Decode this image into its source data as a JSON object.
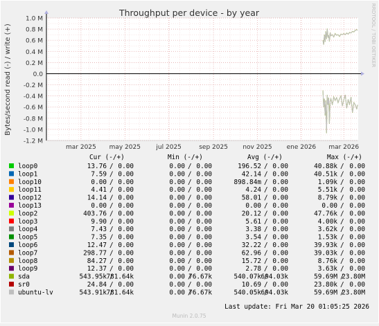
{
  "page": {
    "title": "Throughput per device - by year",
    "watermark": "RRDTOOL / TOBI OETIKER",
    "footer": "Munin 2.0.75",
    "last_update": "Last update: Fri Mar 20 01:05:25 2026"
  },
  "legend": {
    "headers": {
      "cur": "Cur (-/+)",
      "min": "Min (-/+)",
      "avg": "Avg (-/+)",
      "max": "Max (-/+)"
    },
    "rows": [
      {
        "name": "loop0",
        "color": "#00cc00",
        "cur_r": "13.76",
        "cur_w": "0.00",
        "min_r": "0.00",
        "min_w": "0.00",
        "avg_r": "196.52",
        "avg_w": "0.00",
        "max_r": "40.88k",
        "max_w": "0.00"
      },
      {
        "name": "loop1",
        "color": "#0066b3",
        "cur_r": "7.59",
        "cur_w": "0.00",
        "min_r": "0.00",
        "min_w": "0.00",
        "avg_r": "42.14",
        "avg_w": "0.00",
        "max_r": "40.51k",
        "max_w": "0.00"
      },
      {
        "name": "loop10",
        "color": "#ff8000",
        "cur_r": "0.00",
        "cur_w": "0.00",
        "min_r": "0.00",
        "min_w": "0.00",
        "avg_r": "898.84m",
        "avg_w": "0.00",
        "max_r": "1.09k",
        "max_w": "0.00"
      },
      {
        "name": "loop11",
        "color": "#ffcc00",
        "cur_r": "4.41",
        "cur_w": "0.00",
        "min_r": "0.00",
        "min_w": "0.00",
        "avg_r": "4.24",
        "avg_w": "0.00",
        "max_r": "5.51k",
        "max_w": "0.00"
      },
      {
        "name": "loop12",
        "color": "#330099",
        "cur_r": "14.14",
        "cur_w": "0.00",
        "min_r": "0.00",
        "min_w": "0.00",
        "avg_r": "58.01",
        "avg_w": "0.00",
        "max_r": "8.79k",
        "max_w": "0.00"
      },
      {
        "name": "loop13",
        "color": "#990099",
        "cur_r": "0.00",
        "cur_w": "0.00",
        "min_r": "0.00",
        "min_w": "0.00",
        "avg_r": "0.00",
        "avg_w": "0.00",
        "max_r": "0.00",
        "max_w": "0.00"
      },
      {
        "name": "loop2",
        "color": "#ccff00",
        "cur_r": "403.76",
        "cur_w": "0.00",
        "min_r": "0.00",
        "min_w": "0.00",
        "avg_r": "20.12",
        "avg_w": "0.00",
        "max_r": "47.76k",
        "max_w": "0.00"
      },
      {
        "name": "loop3",
        "color": "#ff0000",
        "cur_r": "9.90",
        "cur_w": "0.00",
        "min_r": "0.00",
        "min_w": "0.00",
        "avg_r": "5.61",
        "avg_w": "0.00",
        "max_r": "4.00k",
        "max_w": "0.00"
      },
      {
        "name": "loop4",
        "color": "#808080",
        "cur_r": "7.43",
        "cur_w": "0.00",
        "min_r": "0.00",
        "min_w": "0.00",
        "avg_r": "3.38",
        "avg_w": "0.00",
        "max_r": "3.62k",
        "max_w": "0.00"
      },
      {
        "name": "loop5",
        "color": "#008f00",
        "cur_r": "7.35",
        "cur_w": "0.00",
        "min_r": "0.00",
        "min_w": "0.00",
        "avg_r": "3.54",
        "avg_w": "0.00",
        "max_r": "1.53k",
        "max_w": "0.00"
      },
      {
        "name": "loop6",
        "color": "#00487d",
        "cur_r": "12.47",
        "cur_w": "0.00",
        "min_r": "0.00",
        "min_w": "0.00",
        "avg_r": "32.22",
        "avg_w": "0.00",
        "max_r": "39.93k",
        "max_w": "0.00"
      },
      {
        "name": "loop7",
        "color": "#b35a00",
        "cur_r": "298.77",
        "cur_w": "0.00",
        "min_r": "0.00",
        "min_w": "0.00",
        "avg_r": "62.96",
        "avg_w": "0.00",
        "max_r": "39.03k",
        "max_w": "0.00"
      },
      {
        "name": "loop8",
        "color": "#b38f00",
        "cur_r": "84.27",
        "cur_w": "0.00",
        "min_r": "0.00",
        "min_w": "0.00",
        "avg_r": "15.72",
        "avg_w": "0.00",
        "max_r": "8.76k",
        "max_w": "0.00"
      },
      {
        "name": "loop9",
        "color": "#6b006b",
        "cur_r": "12.37",
        "cur_w": "0.00",
        "min_r": "0.00",
        "min_w": "0.00",
        "avg_r": "2.78",
        "avg_w": "0.00",
        "max_r": "3.63k",
        "max_w": "0.00"
      },
      {
        "name": "sda",
        "color": "#8fb300",
        "cur_r": "543.95k",
        "cur_w": "781.64k",
        "min_r": "0.00",
        "min_w": "76.67k",
        "avg_r": "540.07k",
        "avg_w": "694.03k",
        "max_r": "59.69M",
        "max_w": "23.80M"
      },
      {
        "name": "sr0",
        "color": "#b30000",
        "cur_r": "24.84",
        "cur_w": "0.00",
        "min_r": "0.00",
        "min_w": "0.00",
        "avg_r": "10.69",
        "avg_w": "0.00",
        "max_r": "23.80k",
        "max_w": "0.00"
      },
      {
        "name": "ubuntu-lv",
        "color": "#bebebe",
        "cur_r": "543.91k",
        "cur_w": "781.64k",
        "min_r": "0.00",
        "min_w": "76.67k",
        "avg_r": "540.05k",
        "avg_w": "694.03k",
        "max_r": "59.69M",
        "max_w": "23.80M"
      }
    ]
  },
  "chart_data": {
    "type": "line",
    "title": "Throughput per device - by year",
    "ylabel": "Bytes/second read (-) / write (+)",
    "ylim": [
      -1200000,
      1000000
    ],
    "y_ticks": [
      {
        "v": 1000000,
        "label": "1.0 M"
      },
      {
        "v": 800000,
        "label": "0.8 M"
      },
      {
        "v": 600000,
        "label": "0.6 M"
      },
      {
        "v": 400000,
        "label": "0.4 M"
      },
      {
        "v": 200000,
        "label": "0.2 M"
      },
      {
        "v": 0,
        "label": "0.0"
      },
      {
        "v": -200000,
        "label": "-0.2 M"
      },
      {
        "v": -400000,
        "label": "-0.4 M"
      },
      {
        "v": -600000,
        "label": "-0.6 M"
      },
      {
        "v": -800000,
        "label": "-0.8 M"
      },
      {
        "v": -1000000,
        "label": "-1.0 M"
      },
      {
        "v": -1200000,
        "label": "-1.2 M"
      }
    ],
    "x_range": [
      "2025-01-12",
      "2026-03-21"
    ],
    "x_ticks": [
      {
        "date": "2025-03-01",
        "label": "mar 2025"
      },
      {
        "date": "2025-05-01",
        "label": "may 2025"
      },
      {
        "date": "2025-07-01",
        "label": "jul 2025"
      },
      {
        "date": "2025-09-01",
        "label": "sep 2025"
      },
      {
        "date": "2025-11-01",
        "label": "nov 2025"
      },
      {
        "date": "2026-01-01",
        "label": "ene 2026"
      },
      {
        "date": "2026-03-01",
        "label": "mar 2026"
      }
    ],
    "grid": true,
    "series": [
      {
        "name": "sda",
        "color": "#8fb300",
        "write": [
          [
            "2026-01-31",
            600000
          ],
          [
            "2026-02-01",
            520000
          ],
          [
            "2026-02-02",
            700000
          ],
          [
            "2026-02-03",
            570000
          ],
          [
            "2026-02-04",
            760000
          ],
          [
            "2026-02-05",
            620000
          ],
          [
            "2026-02-06",
            810000
          ],
          [
            "2026-02-07",
            650000
          ],
          [
            "2026-02-08",
            690000
          ],
          [
            "2026-02-09",
            580000
          ],
          [
            "2026-02-10",
            740000
          ],
          [
            "2026-02-11",
            680000
          ],
          [
            "2026-02-13",
            700000
          ],
          [
            "2026-02-15",
            660000
          ],
          [
            "2026-02-17",
            720000
          ],
          [
            "2026-02-19",
            690000
          ],
          [
            "2026-02-21",
            700000
          ],
          [
            "2026-02-23",
            670000
          ],
          [
            "2026-02-25",
            710000
          ],
          [
            "2026-02-27",
            700000
          ],
          [
            "2026-03-01",
            720000
          ],
          [
            "2026-03-03",
            700000
          ],
          [
            "2026-03-05",
            730000
          ],
          [
            "2026-03-07",
            710000
          ],
          [
            "2026-03-09",
            740000
          ],
          [
            "2026-03-11",
            730000
          ],
          [
            "2026-03-13",
            760000
          ],
          [
            "2026-03-15",
            750000
          ],
          [
            "2026-03-17",
            780000
          ],
          [
            "2026-03-19",
            790000
          ],
          [
            "2026-03-20",
            780000
          ]
        ],
        "read": [
          [
            "2026-01-31",
            -300000
          ],
          [
            "2026-02-01",
            -600000
          ],
          [
            "2026-02-02",
            -450000
          ],
          [
            "2026-02-03",
            -750000
          ],
          [
            "2026-02-04",
            -480000
          ],
          [
            "2026-02-05",
            -1070000
          ],
          [
            "2026-02-06",
            -380000
          ],
          [
            "2026-02-07",
            -560000
          ],
          [
            "2026-02-08",
            -430000
          ],
          [
            "2026-02-09",
            -900000
          ],
          [
            "2026-02-10",
            -500000
          ],
          [
            "2026-02-11",
            -440000
          ],
          [
            "2026-02-13",
            -560000
          ],
          [
            "2026-02-15",
            -420000
          ],
          [
            "2026-02-17",
            -480000
          ],
          [
            "2026-02-19",
            -430000
          ],
          [
            "2026-02-21",
            -520000
          ],
          [
            "2026-02-23",
            -450000
          ],
          [
            "2026-02-25",
            -400000
          ],
          [
            "2026-02-27",
            -580000
          ],
          [
            "2026-03-01",
            -470000
          ],
          [
            "2026-03-03",
            -380000
          ],
          [
            "2026-03-05",
            -620000
          ],
          [
            "2026-03-07",
            -460000
          ],
          [
            "2026-03-09",
            -560000
          ],
          [
            "2026-03-11",
            -420000
          ],
          [
            "2026-03-13",
            -700000
          ],
          [
            "2026-03-15",
            -520000
          ],
          [
            "2026-03-17",
            -560000
          ],
          [
            "2026-03-19",
            -640000
          ],
          [
            "2026-03-20",
            -560000
          ]
        ]
      },
      {
        "name": "ubuntu-lv",
        "color": "#bebebe",
        "write": [
          [
            "2026-01-31",
            598000
          ],
          [
            "2026-02-01",
            522000
          ],
          [
            "2026-02-02",
            698000
          ],
          [
            "2026-02-03",
            572000
          ],
          [
            "2026-02-04",
            758000
          ],
          [
            "2026-02-05",
            622000
          ],
          [
            "2026-02-06",
            808000
          ],
          [
            "2026-02-07",
            652000
          ],
          [
            "2026-02-08",
            688000
          ],
          [
            "2026-02-09",
            582000
          ],
          [
            "2026-02-10",
            738000
          ],
          [
            "2026-02-11",
            682000
          ],
          [
            "2026-02-13",
            698000
          ],
          [
            "2026-02-15",
            662000
          ],
          [
            "2026-02-17",
            718000
          ],
          [
            "2026-02-19",
            692000
          ],
          [
            "2026-02-21",
            698000
          ],
          [
            "2026-02-23",
            672000
          ],
          [
            "2026-02-25",
            708000
          ],
          [
            "2026-02-27",
            702000
          ],
          [
            "2026-03-01",
            718000
          ],
          [
            "2026-03-03",
            702000
          ],
          [
            "2026-03-05",
            728000
          ],
          [
            "2026-03-07",
            712000
          ],
          [
            "2026-03-09",
            738000
          ],
          [
            "2026-03-11",
            732000
          ],
          [
            "2026-03-13",
            758000
          ],
          [
            "2026-03-15",
            752000
          ],
          [
            "2026-03-17",
            778000
          ],
          [
            "2026-03-19",
            788000
          ],
          [
            "2026-03-20",
            778000
          ]
        ],
        "read": [
          [
            "2026-01-31",
            -302000
          ],
          [
            "2026-02-01",
            -598000
          ],
          [
            "2026-02-02",
            -452000
          ],
          [
            "2026-02-03",
            -748000
          ],
          [
            "2026-02-04",
            -482000
          ],
          [
            "2026-02-05",
            -1068000
          ],
          [
            "2026-02-06",
            -382000
          ],
          [
            "2026-02-07",
            -558000
          ],
          [
            "2026-02-08",
            -432000
          ],
          [
            "2026-02-09",
            -898000
          ],
          [
            "2026-02-10",
            -502000
          ],
          [
            "2026-02-11",
            -442000
          ],
          [
            "2026-02-13",
            -558000
          ],
          [
            "2026-02-15",
            -422000
          ],
          [
            "2026-02-17",
            -478000
          ],
          [
            "2026-02-19",
            -432000
          ],
          [
            "2026-02-21",
            -518000
          ],
          [
            "2026-02-23",
            -452000
          ],
          [
            "2026-02-25",
            -402000
          ],
          [
            "2026-02-27",
            -578000
          ],
          [
            "2026-03-01",
            -472000
          ],
          [
            "2026-03-03",
            -382000
          ],
          [
            "2026-03-05",
            -618000
          ],
          [
            "2026-03-07",
            -462000
          ],
          [
            "2026-03-09",
            -558000
          ],
          [
            "2026-03-11",
            -422000
          ],
          [
            "2026-03-13",
            -698000
          ],
          [
            "2026-03-15",
            -522000
          ],
          [
            "2026-03-17",
            -558000
          ],
          [
            "2026-03-19",
            -638000
          ],
          [
            "2026-03-20",
            -558000
          ]
        ]
      }
    ]
  }
}
